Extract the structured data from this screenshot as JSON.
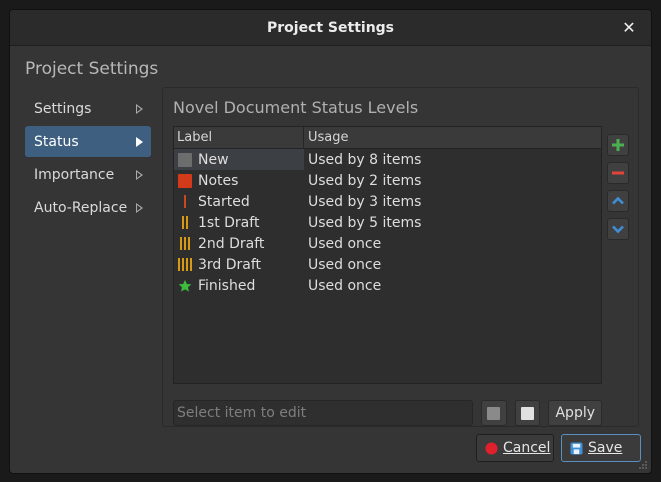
{
  "window": {
    "title": "Project Settings",
    "close_glyph": "✕"
  },
  "header": "Project Settings",
  "sidebar": {
    "items": [
      {
        "label": "Settings",
        "active": false
      },
      {
        "label": "Status",
        "active": true
      },
      {
        "label": "Importance",
        "active": false
      },
      {
        "label": "Auto-Replace",
        "active": false
      }
    ]
  },
  "panel": {
    "title": "Novel Document Status Levels",
    "columns": {
      "label": "Label",
      "usage": "Usage"
    },
    "rows": [
      {
        "label": "New",
        "usage": "Used by 8 items",
        "icon": "square-icon",
        "color": "#6d6d6d",
        "selected": true
      },
      {
        "label": "Notes",
        "usage": "Used by 2 items",
        "icon": "square-icon",
        "color": "#d23a1a"
      },
      {
        "label": "Started",
        "usage": "Used by 3 items",
        "icon": "bars-1-icon",
        "color": "#c8491f"
      },
      {
        "label": "1st Draft",
        "usage": "Used by 5 items",
        "icon": "bars-2-icon",
        "color": "#d89a14"
      },
      {
        "label": "2nd Draft",
        "usage": "Used once",
        "icon": "bars-3-icon",
        "color": "#d89a14"
      },
      {
        "label": "3rd Draft",
        "usage": "Used once",
        "icon": "bars-4-icon",
        "color": "#d89a14"
      },
      {
        "label": "Finished",
        "usage": "Used once",
        "icon": "star-icon",
        "color": "#3dbb3d"
      }
    ],
    "tools": [
      {
        "name": "add-button",
        "icon": "plus-icon",
        "color": "#4caf50"
      },
      {
        "name": "remove-button",
        "icon": "minus-icon",
        "color": "#e0443a"
      },
      {
        "name": "move-up-button",
        "icon": "chevron-up-icon",
        "color": "#3f8fd6"
      },
      {
        "name": "move-down-button",
        "icon": "chevron-down-icon",
        "color": "#3f8fd6"
      }
    ],
    "edit": {
      "placeholder": "Select item to edit",
      "color_swatch": "#8a8a8a",
      "icon_swatch": "#e0e0e0",
      "apply_label": "Apply"
    }
  },
  "footer": {
    "cancel_label": "Cancel",
    "save_label": "Save",
    "cancel_color": "#e0202a",
    "save_color": "#3f8fd6"
  }
}
